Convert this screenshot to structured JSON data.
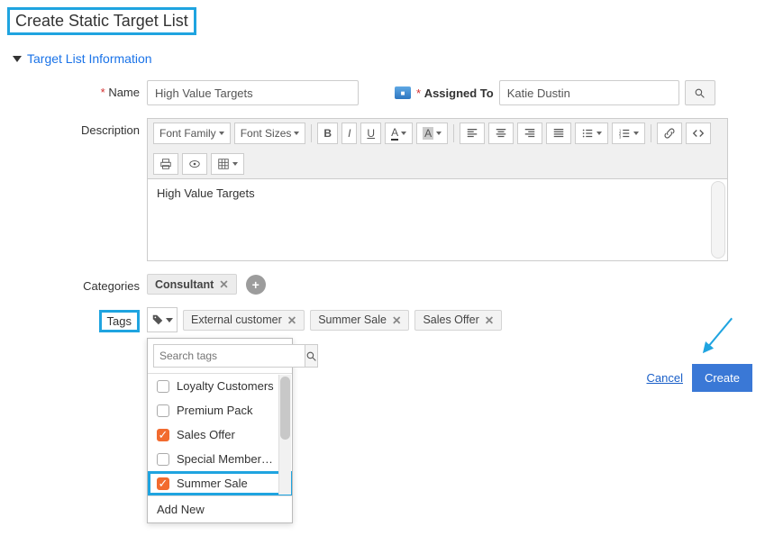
{
  "page": {
    "title": "Create Static Target List"
  },
  "section": {
    "title": "Target List Information"
  },
  "labels": {
    "name": "Name",
    "assigned_to": "Assigned To",
    "description": "Description",
    "categories": "Categories",
    "tags": "Tags"
  },
  "fields": {
    "name": "High Value Targets",
    "assigned_to": "Katie Dustin",
    "description": "High Value Targets"
  },
  "editor_toolbar": {
    "font_family": "Font Family",
    "font_sizes": "Font Sizes"
  },
  "categories": [
    "Consultant"
  ],
  "tags_selected": [
    "External customer",
    "Summer Sale",
    "Sales Offer"
  ],
  "tags_dropdown": {
    "search_placeholder": "Search tags",
    "items": [
      {
        "label": "Loyalty Customers",
        "checked": false
      },
      {
        "label": "Premium Pack",
        "checked": false
      },
      {
        "label": "Sales Offer",
        "checked": true
      },
      {
        "label": "Special Member…",
        "checked": false
      },
      {
        "label": "Summer Sale",
        "checked": true,
        "highlight": true
      }
    ],
    "add_new": "Add New"
  },
  "actions": {
    "cancel": "Cancel",
    "create": "Create"
  }
}
